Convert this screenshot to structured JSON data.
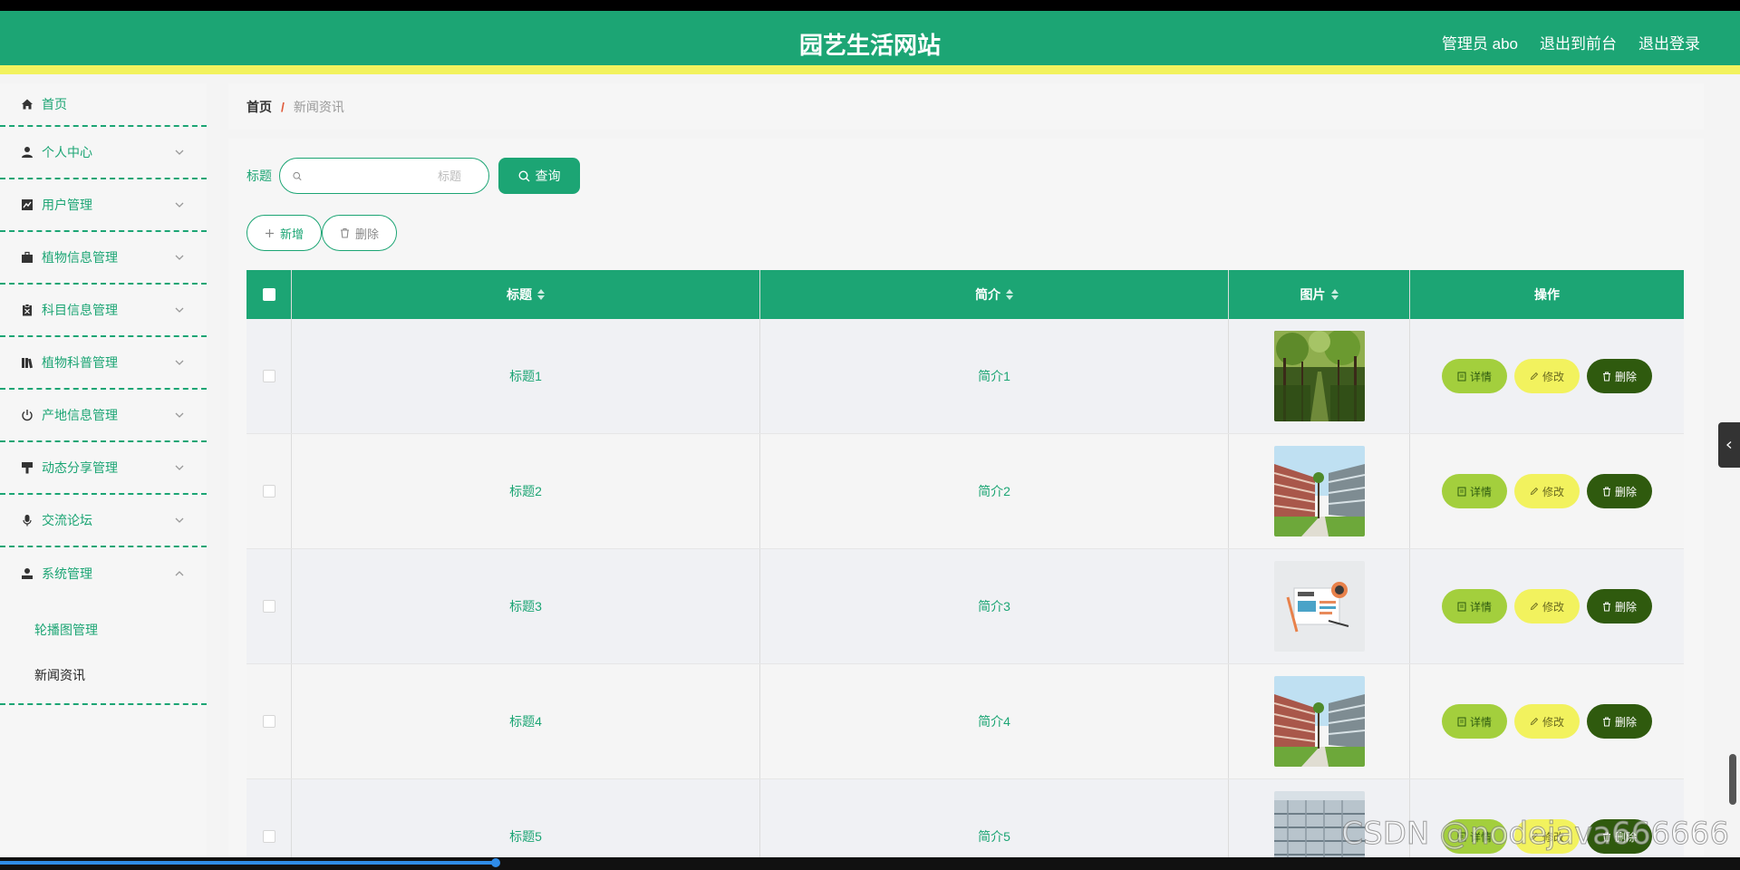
{
  "header": {
    "title": "园艺生活网站",
    "user": "管理员 abo",
    "to_front": "退出到前台",
    "logout": "退出登录"
  },
  "sidebar": {
    "items": [
      {
        "label": "首页",
        "icon": "home-icon"
      },
      {
        "label": "个人中心",
        "icon": "user-icon"
      },
      {
        "label": "用户管理",
        "icon": "chart-icon"
      },
      {
        "label": "植物信息管理",
        "icon": "briefcase-icon"
      },
      {
        "label": "科目信息管理",
        "icon": "clipboard-icon"
      },
      {
        "label": "植物科普管理",
        "icon": "books-icon"
      },
      {
        "label": "产地信息管理",
        "icon": "power-icon"
      },
      {
        "label": "动态分享管理",
        "icon": "brush-icon"
      },
      {
        "label": "交流论坛",
        "icon": "microphone-icon"
      },
      {
        "label": "系统管理",
        "icon": "stamp-icon"
      }
    ],
    "sub_items": [
      {
        "label": "轮播图管理"
      },
      {
        "label": "新闻资讯"
      }
    ]
  },
  "breadcrumb": {
    "home": "首页",
    "separator": "/",
    "current": "新闻资讯"
  },
  "search": {
    "label": "标题",
    "placeholder": "标题",
    "value": "",
    "button": "查询"
  },
  "actions": {
    "add": "新增",
    "delete": "删除"
  },
  "table": {
    "headers": {
      "title": "标题",
      "intro": "简介",
      "pic": "图片",
      "op": "操作"
    },
    "rows": [
      {
        "title": "标题1",
        "intro": "简介1",
        "pic": "forest-path"
      },
      {
        "title": "标题2",
        "intro": "简介2",
        "pic": "campus-building"
      },
      {
        "title": "标题3",
        "intro": "简介3",
        "pic": "news-illustration"
      },
      {
        "title": "标题4",
        "intro": "简介4",
        "pic": "campus-building"
      },
      {
        "title": "标题5",
        "intro": "简介5",
        "pic": "office-building"
      }
    ],
    "buttons": {
      "detail": "详情",
      "edit": "修改",
      "remove": "删除"
    }
  },
  "watermark": "CSDN @nodejava666666",
  "colors": {
    "primary": "#1ca574",
    "accent_yellow": "#f2f25e",
    "detail_btn": "#a3cf3d",
    "remove_btn": "#2f5a0e"
  }
}
